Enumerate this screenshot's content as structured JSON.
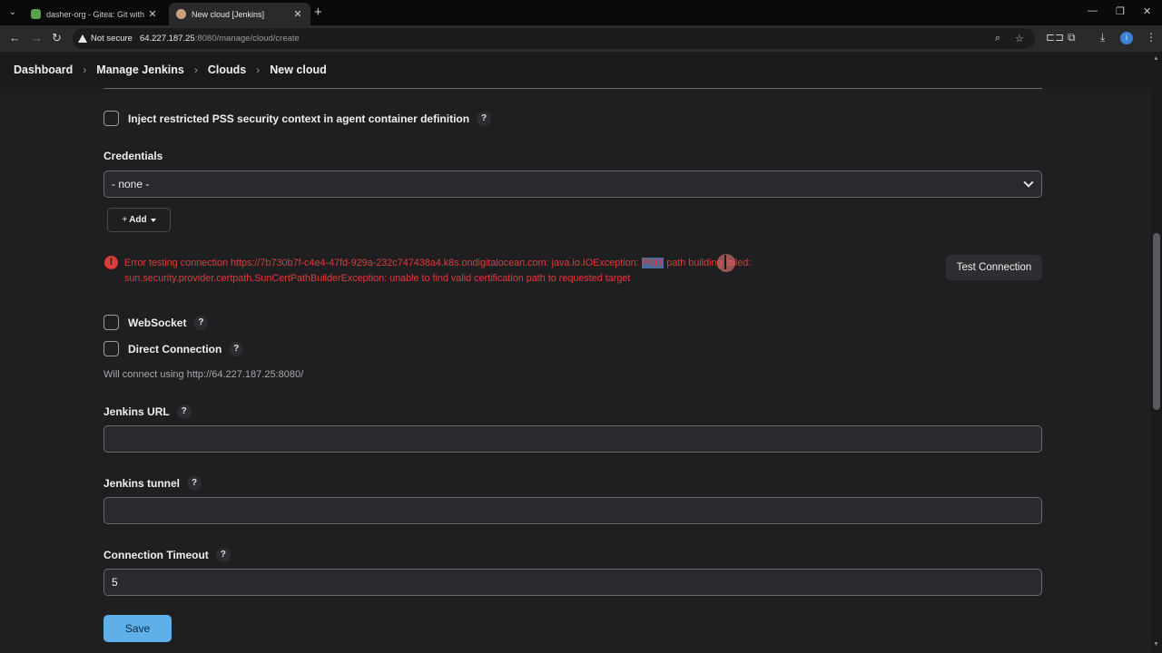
{
  "browser": {
    "tabs": [
      {
        "title": "dasher-org - Gitea: Git with a c",
        "favicon_color": "#5ca44c"
      },
      {
        "title": "New cloud [Jenkins]",
        "favicon_color": "#c9a27a"
      }
    ],
    "security_label": "Not secure",
    "url_host": "64.227.187.25",
    "url_path": ":8080/manage/cloud/create",
    "profile_initial": "i"
  },
  "breadcrumbs": [
    "Dashboard",
    "Manage Jenkins",
    "Clouds",
    "New cloud"
  ],
  "form": {
    "inject_pss_label": "Inject restricted PSS security context in agent container definition",
    "credentials_label": "Credentials",
    "credentials_value": "- none -",
    "add_label": "Add",
    "error": {
      "before_highlight": "Error testing connection https://7b730b7f-c4e4-47fd-929a-232c747438a4.k8s.ondigitalocean.com: java.io.IOException: ",
      "highlight": "PKIX",
      "after_highlight": " path building failed: sun.security.provider.certpath.SunCertPathBuilderException: unable to find valid certification path to requested target"
    },
    "test_connection_label": "Test Connection",
    "websocket_label": "WebSocket",
    "direct_connection_label": "Direct Connection",
    "will_connect_text": "Will connect using http://64.227.187.25:8080/",
    "jenkins_url_label": "Jenkins URL",
    "jenkins_url_value": "",
    "jenkins_tunnel_label": "Jenkins tunnel",
    "jenkins_tunnel_value": "",
    "connection_timeout_label": "Connection Timeout",
    "connection_timeout_value": "5",
    "save_label": "Save",
    "help_glyph": "?"
  },
  "colors": {
    "error": "#e03a3a",
    "save_button": "#5fb0e8",
    "background": "#1f1f22"
  }
}
